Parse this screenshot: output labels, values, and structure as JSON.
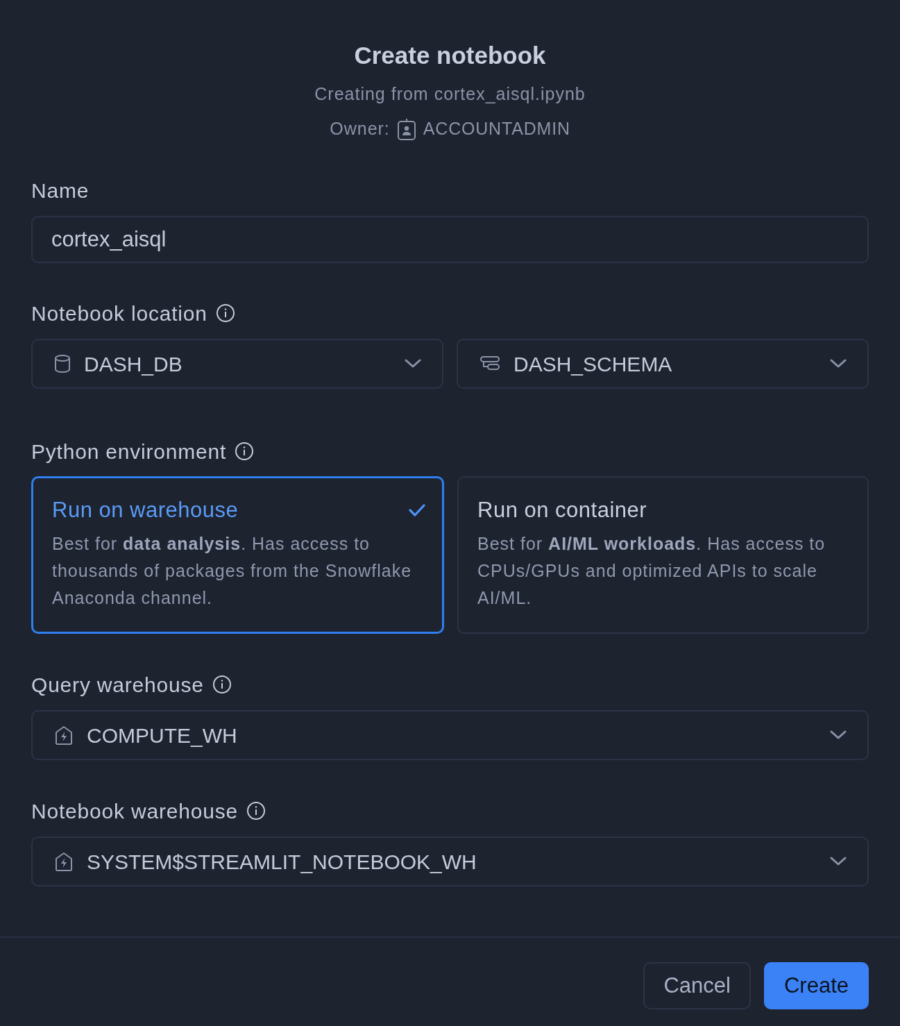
{
  "dialog": {
    "title": "Create notebook",
    "subtitle": "Creating from cortex_aisql.ipynb",
    "owner_label": "Owner:",
    "owner": "ACCOUNTADMIN"
  },
  "fields": [
    {
      "kind": "text",
      "label": "Name",
      "info": false,
      "value": "cortex_aisql"
    },
    {
      "kind": "location",
      "label": "Notebook location",
      "info": true,
      "selects": [
        {
          "value": "DASH_DB"
        },
        {
          "value": "DASH_SCHEMA"
        }
      ]
    },
    {
      "kind": "environment",
      "label": "Python environment",
      "info": true,
      "options": [
        {
          "title": "Run on warehouse",
          "description": "Best for **data analysis**. Has access to thousands of packages from the Snowflake Anaconda channel.",
          "selected": true
        },
        {
          "title": "Run on container",
          "description": "Best for **AI/ML workloads**. Has access to CPUs/GPUs and optimized APIs to scale AI/ML.",
          "selected": false
        }
      ]
    },
    {
      "kind": "warehouse",
      "label": "Query warehouse",
      "info": true,
      "selects": [
        {
          "value": "COMPUTE_WH"
        }
      ]
    },
    {
      "kind": "warehouse",
      "label": "Notebook warehouse",
      "info": true,
      "selects": [
        {
          "value": "SYSTEM$STREAMLIT_NOTEBOOK_WH"
        }
      ]
    }
  ],
  "footer": {
    "buttons": [
      {
        "label": "Cancel",
        "kind": "secondary"
      },
      {
        "label": "Create",
        "kind": "primary"
      }
    ]
  }
}
